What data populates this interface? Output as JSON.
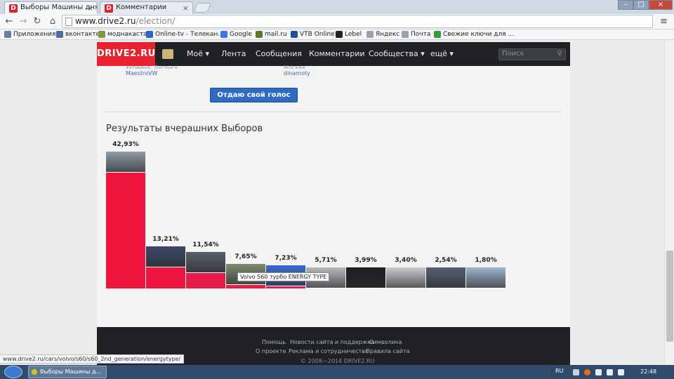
{
  "browser": {
    "tabs": [
      {
        "title": "Выборы Машины дня",
        "favicon": "D",
        "active": true
      },
      {
        "title": "Комментарии",
        "favicon": "D",
        "active": false
      }
    ],
    "url_host": "www.drive2.ru",
    "url_path": "/election/",
    "bookmarks": [
      {
        "label": "Приложения",
        "color": "#6b7fa3"
      },
      {
        "label": "вконтакте",
        "color": "#4a6d99"
      },
      {
        "label": "моднакаста",
        "color": "#7b9a3a"
      },
      {
        "label": "Online-tv - Телекан...",
        "color": "#2a6bbf"
      },
      {
        "label": "Google",
        "color": "#3b78e7"
      },
      {
        "label": "mail.ru",
        "color": "#5a7a2a"
      },
      {
        "label": "VTB Online",
        "color": "#1e4f9a"
      },
      {
        "label": "Lebel",
        "color": "#222222"
      },
      {
        "label": "Яндекс",
        "color": "#9aa3ad"
      },
      {
        "label": "Почта",
        "color": "#9aa3ad"
      },
      {
        "label": "Свежие ключи для ...",
        "color": "#3a9a3a"
      }
    ],
    "status_url": "www.drive2.ru/cars/volvo/s60/s60_2nd_generation/energytype/"
  },
  "site": {
    "logo": "DRIVE2.RU",
    "nav": [
      "Моё ▾",
      "Лента",
      "Сообщения",
      "Комментарии",
      "Сообщества ▾",
      "ещё ▾"
    ],
    "search_placeholder": "Поиск",
    "accent": "#e6232e"
  },
  "voters": {
    "left_cut": "Украина, Луганск",
    "left": "MaestroVW",
    "right_cut": "Москва",
    "right": "dinamoty"
  },
  "vote_button": "Отдаю свой голос",
  "results_title": "Результаты вчерашних Выборов",
  "tooltip": "Volvo S60 турбо ENERGY TYPE",
  "chart_data": {
    "type": "bar",
    "categories": [
      "",
      "",
      "",
      "",
      "",
      "",
      "",
      "",
      "",
      ""
    ],
    "values": [
      42.93,
      13.21,
      11.54,
      7.65,
      7.23,
      5.71,
      3.99,
      3.4,
      2.54,
      1.8
    ],
    "labels": [
      "42,93%",
      "13,21%",
      "11,54%",
      "7,65%",
      "7,23%",
      "5,71%",
      "3,99%",
      "3,40%",
      "2,54%",
      "1,80%"
    ],
    "bar_colors": [
      "#f0153d",
      "#ee1543",
      "#e81b48",
      "#e31e4b",
      "#de204e",
      "#d42452",
      "#c82754",
      "#bb2a57",
      "#9b3a62",
      "#7d5a86"
    ],
    "thumb_colors": [
      "#8f9aa3",
      "#3c4a6a",
      "#5a5f6a",
      "#7d8d6d",
      "#3d6bd0",
      "#b5b9bf",
      "#1d1f24",
      "#c9ccd2",
      "#55606e",
      "#9fb3cc"
    ]
  },
  "footer": {
    "row1": [
      "Помощь",
      "Новости сайта и поддержка",
      "Символика"
    ],
    "row2": [
      "О проекте",
      "Реклама и сотрудничество",
      "Правила сайта"
    ],
    "copyright": "© 2008—2014 DRIVE2.RU"
  },
  "taskbar": {
    "app": "Выборы Машины д...",
    "lang": "RU",
    "time": "22:48"
  }
}
